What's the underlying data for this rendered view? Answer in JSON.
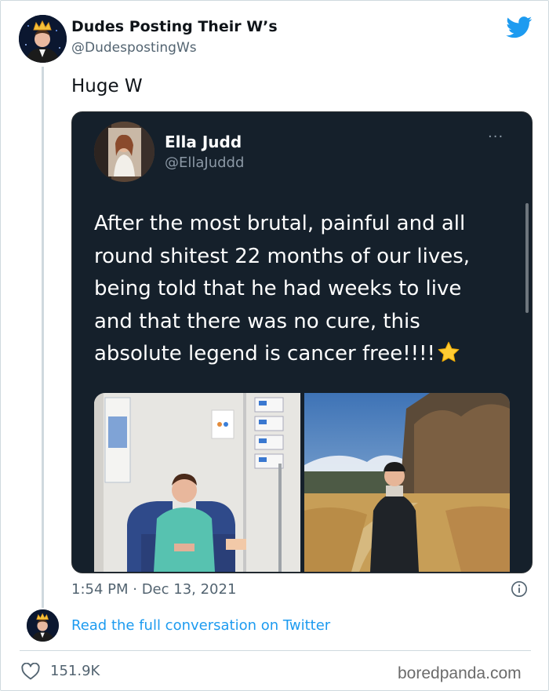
{
  "author": {
    "name": "Dudes Posting Their W’s",
    "handle": "@DudespostingWs",
    "avatar_icon": "crowned-man-avatar"
  },
  "tweet": {
    "text": "Huge W",
    "timestamp": "1:54 PM · Dec 13, 2021",
    "read_full_label": "Read the full conversation on Twitter",
    "like_count": "151.9K"
  },
  "embedded_tweet": {
    "name": "Ella Judd",
    "handle": "@EllaJuddd",
    "more_label": "···",
    "body_lines": [
      "After the most brutal, painful and all",
      "round shitest 22 months of our lives,",
      "being told that he had weeks to live",
      "and that there was no cure, this",
      "absolute legend is cancer free!!!!"
    ],
    "emoji": "star-emoji",
    "photos": [
      "hospital-photo",
      "field-photo"
    ]
  },
  "watermark": "boredpanda.com",
  "colors": {
    "twitter_blue": "#1d9bf0",
    "embed_background": "#15202b",
    "muted_text": "#536471"
  }
}
